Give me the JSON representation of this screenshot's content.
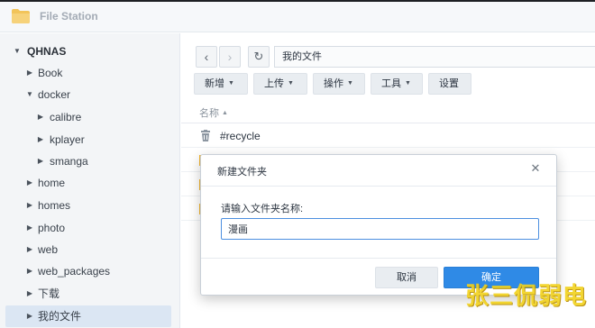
{
  "app": {
    "title": "File Station"
  },
  "sidebar": {
    "items": [
      {
        "label": "QHNAS"
      },
      {
        "label": "Book"
      },
      {
        "label": "docker"
      },
      {
        "label": "calibre"
      },
      {
        "label": "kplayer"
      },
      {
        "label": "smanga"
      },
      {
        "label": "home"
      },
      {
        "label": "homes"
      },
      {
        "label": "photo"
      },
      {
        "label": "web"
      },
      {
        "label": "web_packages"
      },
      {
        "label": "下载"
      },
      {
        "label": "我的文件"
      }
    ],
    "selected": "我的文件"
  },
  "toolbar": {
    "path": "我的文件",
    "buttons": [
      {
        "label": "新增"
      },
      {
        "label": "上传"
      },
      {
        "label": "操作"
      },
      {
        "label": "工具"
      },
      {
        "label": "设置"
      }
    ]
  },
  "list": {
    "column_name": "名称",
    "rows": [
      {
        "name": "#recycle"
      }
    ]
  },
  "dialog": {
    "title": "新建文件夹",
    "label": "请输入文件夹名称:",
    "input_value": "漫画",
    "cancel_label": "取消",
    "ok_label": "确定"
  },
  "watermark": "张三侃弱电",
  "colors": {
    "accent": "#2f8ae6",
    "folder": "#f2b632",
    "selection": "#dbe6f3"
  }
}
